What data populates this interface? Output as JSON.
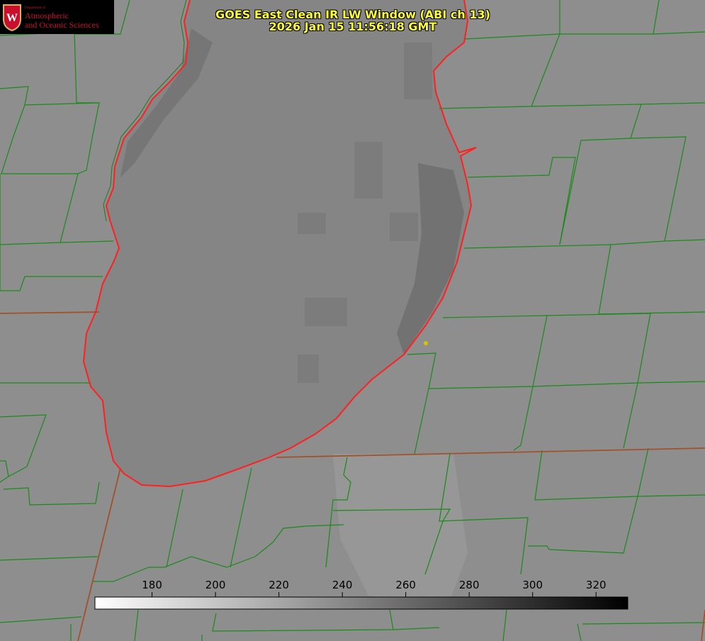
{
  "title": {
    "line1": "GOES East Clean IR LW Window (ABI ch 13)",
    "line2": "2026 Jan 15 11:56:18 GMT"
  },
  "logo": {
    "dept": "Department of",
    "line1": "Atmospheric",
    "line2": "and Oceanic Sciences",
    "seal_letter": "W"
  },
  "colorbar": {
    "min": 162,
    "max": 330,
    "ticks": [
      "180",
      "200",
      "220",
      "240",
      "260",
      "280",
      "300",
      "320"
    ],
    "tick_values": [
      180,
      200,
      220,
      240,
      260,
      280,
      300,
      320
    ]
  },
  "colors": {
    "county_lines": "#1a8a1a",
    "state_line": "#a0522d",
    "coastline": "#ff2020",
    "text": "#ffff33",
    "marker": "#d4c400"
  }
}
